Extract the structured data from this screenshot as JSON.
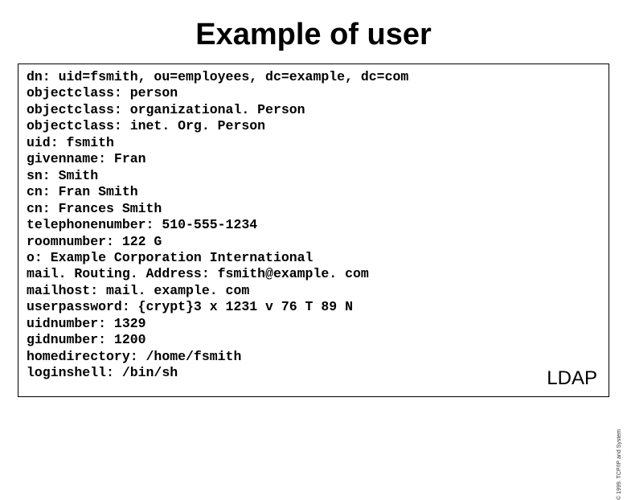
{
  "title": "Example of user",
  "ldif_lines": [
    "dn: uid=fsmith, ou=employees, dc=example, dc=com",
    "objectclass: person",
    "objectclass: organizational. Person",
    "objectclass: inet. Org. Person",
    "uid: fsmith",
    "givenname: Fran",
    "sn: Smith",
    "cn: Fran Smith",
    "cn: Frances Smith",
    "telephonenumber: 510-555-1234",
    "roomnumber: 122 G",
    "o: Example Corporation International",
    "mail. Routing. Address: fsmith@example. com",
    "mailhost: mail. example. com",
    "userpassword: {crypt}3 x 1231 v 76 T 89 N",
    "uidnumber: 1329",
    "gidnumber: 1200",
    "homedirectory: /home/fsmith",
    "loginshell: /bin/sh"
  ],
  "corner_label": "LDAP",
  "sidebar_text": "© 1999. TCP/IP and System"
}
